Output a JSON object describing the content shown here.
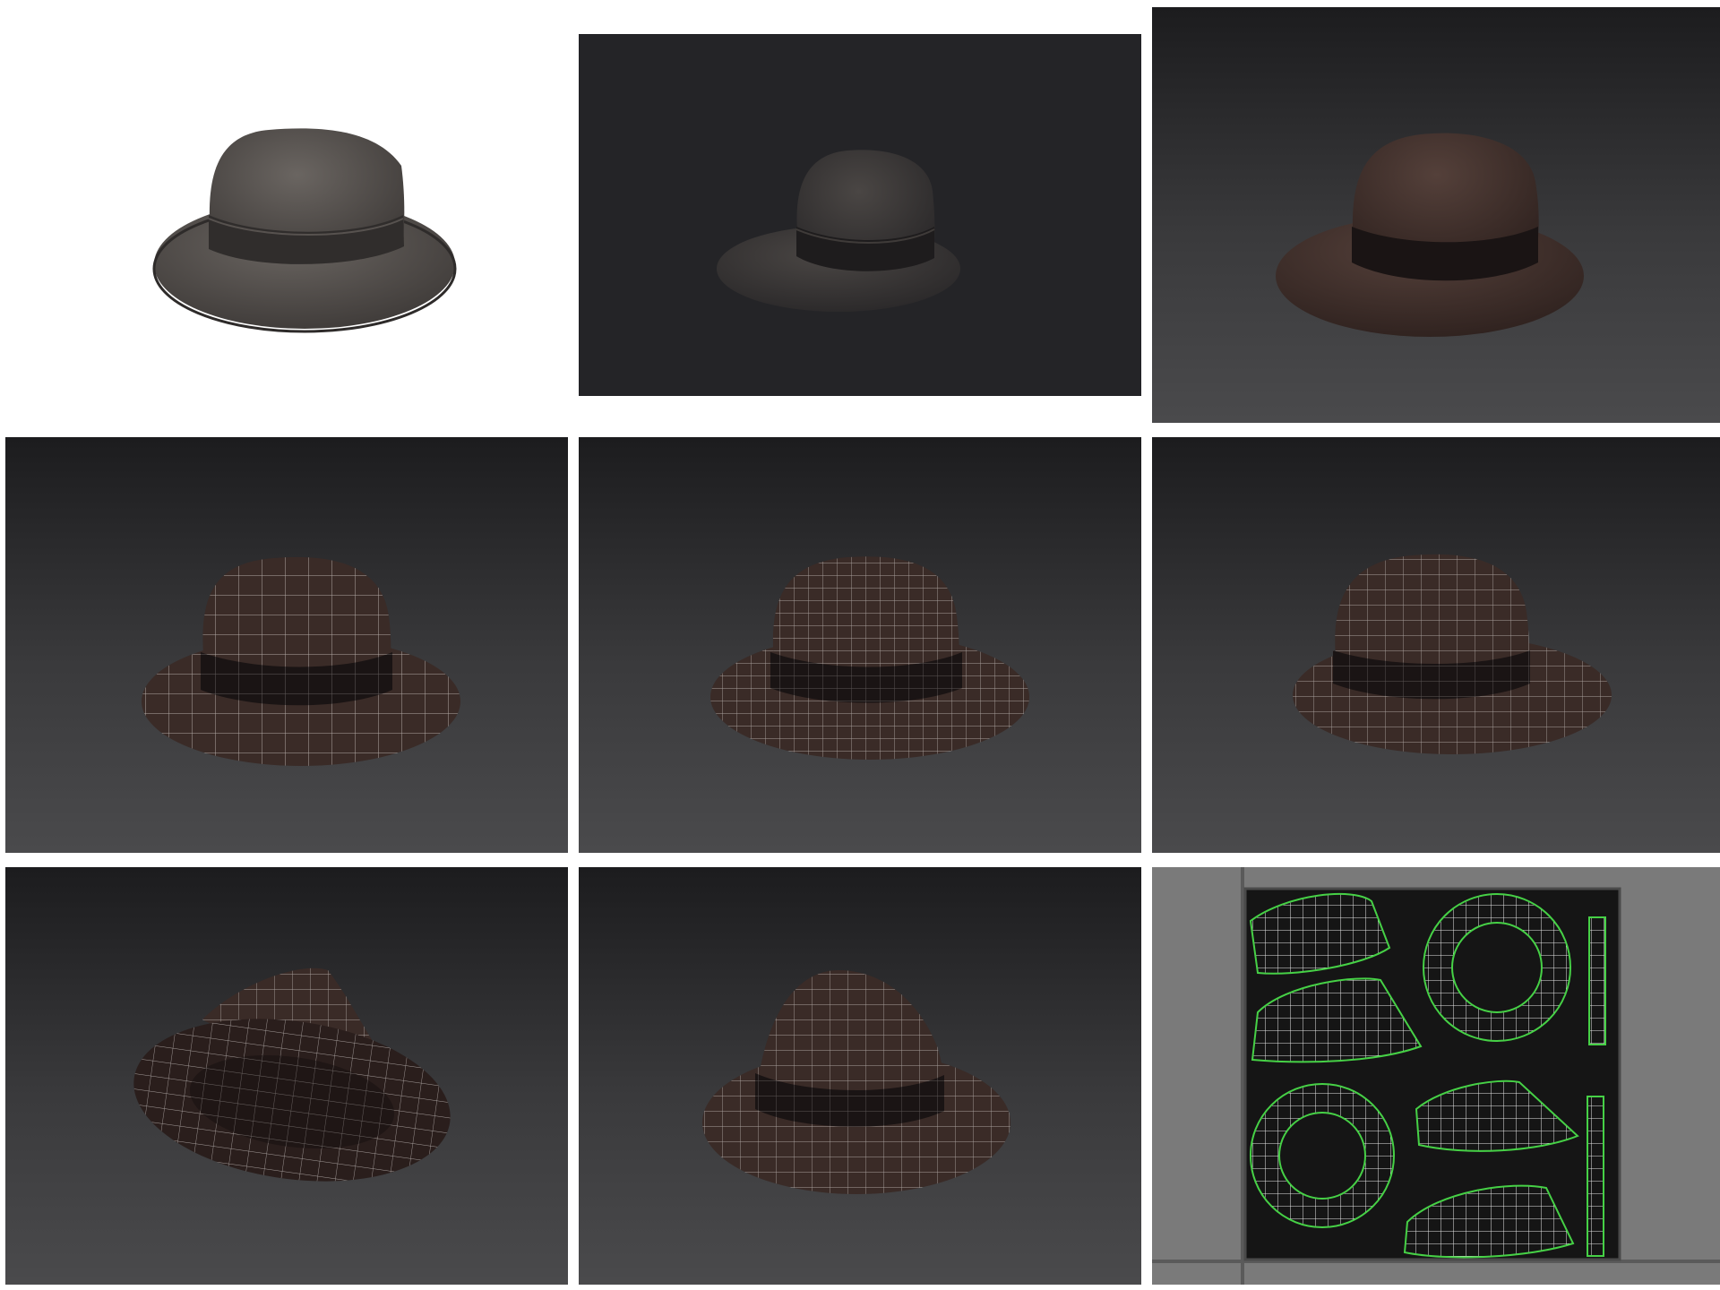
{
  "layout": {
    "background": "#ffffff",
    "rows": 3,
    "columns": 3
  },
  "palette": {
    "viewport_gradient_top": "#1b1b1d",
    "viewport_gradient_bottom": "#4b4b4d",
    "flat_viewport": "#242427",
    "hat_felt_gray": "#4e4a47",
    "hat_felt_brown": "#3b2a26",
    "hat_band": "#1a1414",
    "wire_color": "#d9d4d0",
    "uv_border_color": "#46d146",
    "uv_canvas": "#151515",
    "uv_editor_frame": "#7a7a7a"
  },
  "panels": [
    {
      "name": "render-white-background",
      "kind": "render",
      "background": "white",
      "hat_color": "gray",
      "wireframe": false
    },
    {
      "name": "render-dark-background",
      "kind": "render",
      "background": "flat-dark",
      "hat_color": "dark-gray",
      "wireframe": false
    },
    {
      "name": "render-gradient-background",
      "kind": "render",
      "background": "gradient",
      "hat_color": "brown",
      "wireframe": false
    },
    {
      "name": "wireframe-front-low",
      "kind": "wireframe",
      "background": "gradient",
      "hat_color": "brown",
      "wireframe": true
    },
    {
      "name": "wireframe-front-dense",
      "kind": "wireframe",
      "background": "gradient",
      "hat_color": "brown",
      "wireframe": true
    },
    {
      "name": "wireframe-side",
      "kind": "wireframe",
      "background": "gradient",
      "hat_color": "brown",
      "wireframe": true
    },
    {
      "name": "wireframe-underside",
      "kind": "wireframe",
      "background": "gradient",
      "hat_color": "brown",
      "wireframe": true
    },
    {
      "name": "wireframe-three-quarter",
      "kind": "wireframe",
      "background": "gradient",
      "hat_color": "brown",
      "wireframe": true
    },
    {
      "name": "uv-layout",
      "kind": "uv-editor",
      "background": "gray",
      "islands": [
        "crown-top-left",
        "brim-ring-top",
        "band-strip-top",
        "crown-side-left",
        "brim-ring-bottom",
        "crown-top-right",
        "band-strip-bottom",
        "crown-side-right"
      ]
    }
  ]
}
